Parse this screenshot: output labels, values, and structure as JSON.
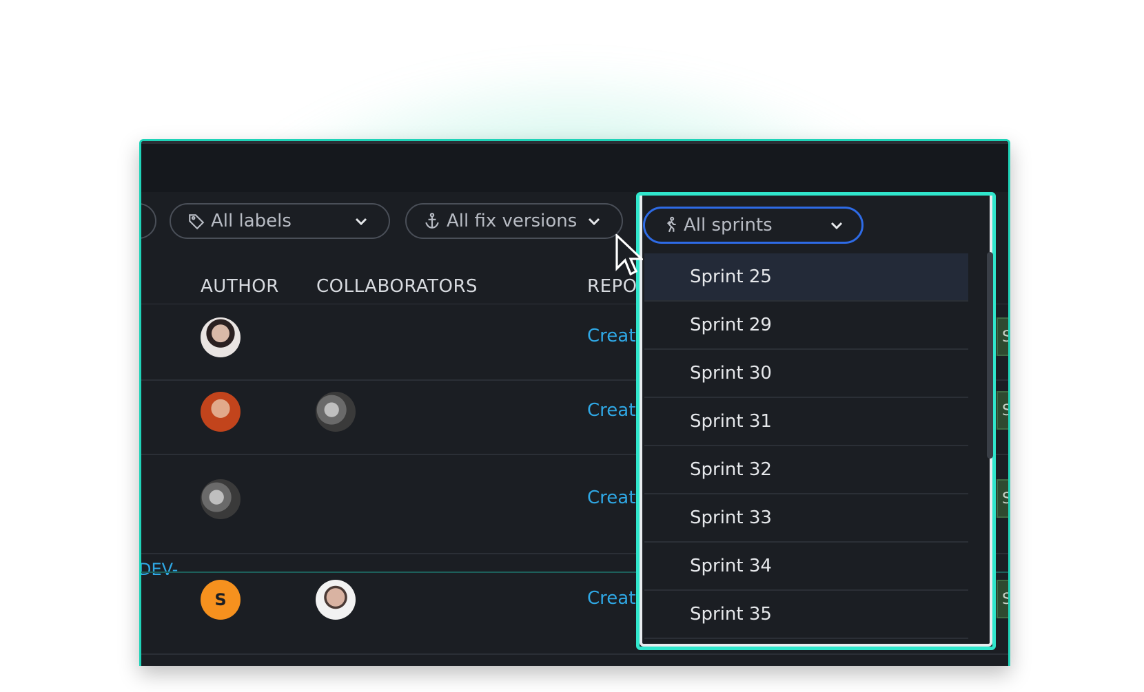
{
  "filters": {
    "labels": {
      "label": "All labels",
      "icon": "tag-icon"
    },
    "fix_versions": {
      "label": "All fix versions",
      "icon": "anchor-icon"
    },
    "sprints": {
      "label": "All sprints",
      "icon": "runner-icon"
    }
  },
  "columns": {
    "author": "AUTHOR",
    "collaborators": "COLLABORATORS",
    "repo": "REPO"
  },
  "rows": [
    {
      "author_avatar": "avatar-photo",
      "collaborator_avatar": "",
      "repo": "Creat",
      "status": "St"
    },
    {
      "author_avatar": "avatar-photo",
      "collaborator_avatar": "avatar-photo",
      "repo": "Creat",
      "status": "St"
    },
    {
      "author_avatar": "avatar-photo",
      "collaborator_avatar": "",
      "repo": "Creat",
      "status": "St"
    },
    {
      "author_initial": "S",
      "collaborator_avatar": "avatar-photo",
      "repo": "Creat",
      "status": "St"
    }
  ],
  "dev_link": "DEV-",
  "sprint_menu": {
    "items": [
      "Sprint 25",
      "Sprint 29",
      "Sprint 30",
      "Sprint 31",
      "Sprint 32",
      "Sprint 33",
      "Sprint 34",
      "Sprint 35"
    ],
    "active_index": 0
  },
  "colors": {
    "accent": "#30e6cc",
    "link": "#2fa8e5",
    "focus_ring": "#2e6be6",
    "background": "#1b1e23"
  }
}
